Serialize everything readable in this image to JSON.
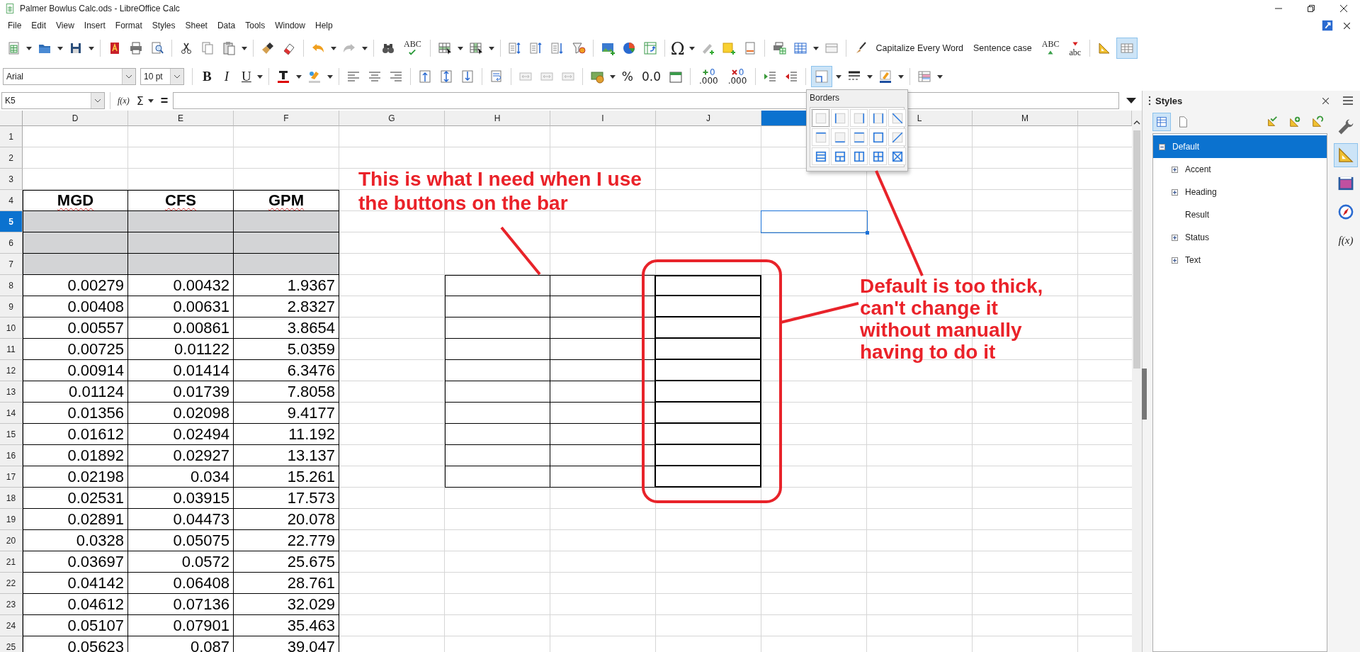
{
  "window": {
    "title": "Palmer Bowlus Calc.ods - LibreOffice Calc"
  },
  "menu": [
    "File",
    "Edit",
    "View",
    "Insert",
    "Format",
    "Styles",
    "Sheet",
    "Data",
    "Tools",
    "Window",
    "Help"
  ],
  "toolbar_standard": {
    "spelling_label": "ABC",
    "special_character": "Ω",
    "capitalize": "Capitalize Every Word",
    "sentence_case": "Sentence case",
    "uppercase": "ABC",
    "lowercase": "abc",
    "grid_lines": {
      "on": true
    }
  },
  "toolbar_formatting": {
    "font_name": "Arial",
    "font_size": "10 pt",
    "bold": "B",
    "italic": "I",
    "underline": "U",
    "percent": "%",
    "standard_format": "0.0",
    "add_decimal": [
      "0",
      ".000"
    ],
    "delete_decimal": [
      "0",
      ".000"
    ],
    "borders": {
      "on": true
    }
  },
  "borders_popup": {
    "title": "Borders"
  },
  "formula_bar": {
    "name_box": "K5",
    "function_wizard": "f(x)",
    "sum": "Σ",
    "equals": "="
  },
  "sheet": {
    "columns": [
      {
        "label": "D",
        "selected": false
      },
      {
        "label": "E",
        "selected": false
      },
      {
        "label": "F",
        "selected": false
      },
      {
        "label": "G",
        "selected": false
      },
      {
        "label": "H",
        "selected": false
      },
      {
        "label": "I",
        "selected": false
      },
      {
        "label": "J",
        "selected": false
      },
      {
        "selected": true
      },
      {
        "label": "L",
        "selected": false
      },
      {
        "label": "M",
        "selected": false
      }
    ],
    "rows": [
      {
        "label": "1",
        "selected": false,
        "kind": "blank"
      },
      {
        "label": "2",
        "selected": false,
        "kind": "blank"
      },
      {
        "label": "3",
        "selected": false,
        "kind": "blank"
      },
      {
        "label": "4",
        "selected": false,
        "kind": "heading",
        "spelling_flagged": true,
        "values": [
          "MGD",
          "CFS",
          "GPM"
        ],
        "framed": [
          true,
          true,
          true
        ]
      },
      {
        "label": "5",
        "selected": true,
        "kind": "shaded",
        "framed": [
          true,
          true,
          true
        ]
      },
      {
        "label": "6",
        "selected": false,
        "kind": "shaded",
        "framed": [
          true,
          true,
          true
        ]
      },
      {
        "label": "7",
        "selected": false,
        "kind": "shaded",
        "framed": [
          true,
          true,
          true
        ]
      },
      {
        "label": "8",
        "selected": false,
        "kind": "number",
        "values": [
          "0.00279",
          "0.00432",
          "1.9367"
        ],
        "framed": [
          true,
          true,
          true,
          false,
          true,
          true,
          true
        ],
        "thick": [
          false,
          false,
          false,
          false,
          false,
          false,
          true
        ]
      },
      {
        "label": "9",
        "selected": false,
        "kind": "number",
        "values": [
          "0.00408",
          "0.00631",
          "2.8327"
        ],
        "framed": [
          true,
          true,
          true,
          false,
          true,
          true,
          true
        ],
        "thick": [
          false,
          false,
          false,
          false,
          false,
          false,
          true
        ]
      },
      {
        "label": "10",
        "selected": false,
        "kind": "number",
        "values": [
          "0.00557",
          "0.00861",
          "3.8654"
        ],
        "framed": [
          true,
          true,
          true,
          false,
          true,
          true,
          true
        ],
        "thick": [
          false,
          false,
          false,
          false,
          false,
          false,
          true
        ]
      },
      {
        "label": "11",
        "selected": false,
        "kind": "number",
        "values": [
          "0.00725",
          "0.01122",
          "5.0359"
        ],
        "framed": [
          true,
          true,
          true,
          false,
          true,
          true,
          true
        ],
        "thick": [
          false,
          false,
          false,
          false,
          false,
          false,
          true
        ]
      },
      {
        "label": "12",
        "selected": false,
        "kind": "number",
        "values": [
          "0.00914",
          "0.01414",
          "6.3476"
        ],
        "framed": [
          true,
          true,
          true,
          false,
          true,
          true,
          true
        ],
        "thick": [
          false,
          false,
          false,
          false,
          false,
          false,
          true
        ]
      },
      {
        "label": "13",
        "selected": false,
        "kind": "number",
        "values": [
          "0.01124",
          "0.01739",
          "7.8058"
        ],
        "framed": [
          true,
          true,
          true,
          false,
          true,
          true,
          true
        ],
        "thick": [
          false,
          false,
          false,
          false,
          false,
          false,
          true
        ]
      },
      {
        "label": "14",
        "selected": false,
        "kind": "number",
        "values": [
          "0.01356",
          "0.02098",
          "9.4177"
        ],
        "framed": [
          true,
          true,
          true,
          false,
          true,
          true,
          true
        ],
        "thick": [
          false,
          false,
          false,
          false,
          false,
          false,
          true
        ]
      },
      {
        "label": "15",
        "selected": false,
        "kind": "number",
        "values": [
          "0.01612",
          "0.02494",
          "11.192"
        ],
        "framed": [
          true,
          true,
          true,
          false,
          true,
          true,
          true
        ],
        "thick": [
          false,
          false,
          false,
          false,
          false,
          false,
          true
        ]
      },
      {
        "label": "16",
        "selected": false,
        "kind": "number",
        "values": [
          "0.01892",
          "0.02927",
          "13.137"
        ],
        "framed": [
          true,
          true,
          true,
          false,
          true,
          true,
          true
        ],
        "thick": [
          false,
          false,
          false,
          false,
          false,
          false,
          true
        ]
      },
      {
        "label": "17",
        "selected": false,
        "kind": "number",
        "values": [
          "0.02198",
          "0.034",
          "15.261"
        ],
        "framed": [
          true,
          true,
          true,
          false,
          true,
          true,
          true
        ],
        "thick": [
          false,
          false,
          false,
          false,
          false,
          false,
          true
        ]
      },
      {
        "label": "18",
        "selected": false,
        "kind": "number",
        "values": [
          "0.02531",
          "0.03915",
          "17.573"
        ],
        "framed": [
          true,
          true,
          true
        ]
      },
      {
        "label": "19",
        "selected": false,
        "kind": "number",
        "values": [
          "0.02891",
          "0.04473",
          "20.078"
        ],
        "framed": [
          true,
          true,
          true
        ]
      },
      {
        "label": "20",
        "selected": false,
        "kind": "number",
        "values": [
          "0.0328",
          "0.05075",
          "22.779"
        ],
        "framed": [
          true,
          true,
          true
        ]
      },
      {
        "label": "21",
        "selected": false,
        "kind": "number",
        "values": [
          "0.03697",
          "0.0572",
          "25.675"
        ],
        "framed": [
          true,
          true,
          true
        ]
      },
      {
        "label": "22",
        "selected": false,
        "kind": "number",
        "values": [
          "0.04142",
          "0.06408",
          "28.761"
        ],
        "framed": [
          true,
          true,
          true
        ]
      },
      {
        "label": "23",
        "selected": false,
        "kind": "number",
        "values": [
          "0.04612",
          "0.07136",
          "32.029"
        ],
        "framed": [
          true,
          true,
          true
        ]
      },
      {
        "label": "24",
        "selected": false,
        "kind": "number",
        "values": [
          "0.05107",
          "0.07901",
          "35.463"
        ],
        "framed": [
          true,
          true,
          true
        ]
      },
      {
        "label": "25",
        "selected": false,
        "kind": "number",
        "values": [
          "0.05623",
          "0.087",
          "39.047"
        ],
        "framed": [
          true,
          true,
          true
        ]
      }
    ]
  },
  "annotations": [
    {
      "text": "This is what I need when I use the buttons on the bar"
    },
    {
      "text": "Default is too thick, can't change it without manually having to do it"
    }
  ],
  "sidebar": {
    "title": "Styles",
    "families": [
      {
        "selected": true
      },
      {
        "selected": false
      }
    ],
    "tree": [
      {
        "label": "Default",
        "selected": true,
        "expanded": true,
        "has_children": true,
        "children": [
          {
            "label": "Accent",
            "selected": false,
            "expanded": false,
            "has_children": true
          },
          {
            "label": "Heading",
            "selected": false,
            "expanded": false,
            "has_children": true
          },
          {
            "label": "Result",
            "selected": false,
            "has_children": false
          },
          {
            "label": "Status",
            "selected": false,
            "expanded": false,
            "has_children": true
          },
          {
            "label": "Text",
            "selected": false,
            "expanded": false,
            "has_children": true
          }
        ]
      }
    ],
    "deck": [
      {
        "selected": false
      },
      {
        "selected": true
      },
      {
        "selected": false
      },
      {
        "selected": false
      },
      {
        "label": "f(x)",
        "selected": false
      }
    ]
  }
}
